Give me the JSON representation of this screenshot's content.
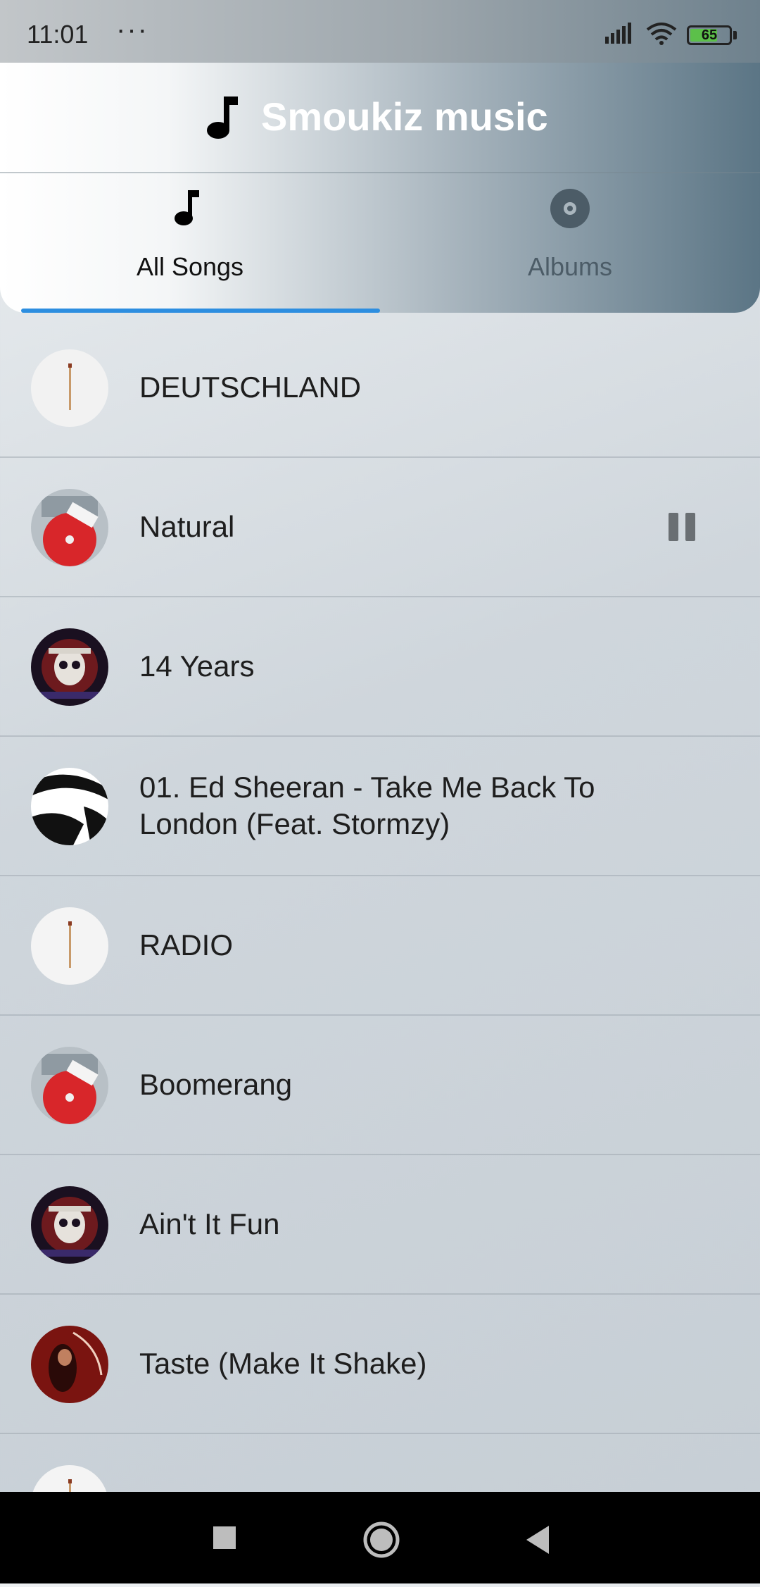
{
  "status_bar": {
    "time": "11:01",
    "more": "···",
    "battery": "65"
  },
  "header": {
    "app_title": "Smoukiz music",
    "title_icon": "music-note-icon",
    "tabs": [
      {
        "label": "All Songs",
        "icon": "music-note-icon",
        "selected": true
      },
      {
        "label": "Albums",
        "icon": "disc-icon",
        "selected": false
      }
    ],
    "accent_color": "#2d8ee0"
  },
  "songs": [
    {
      "title": "DEUTSCHLAND",
      "cover": "matchstick-cover"
    },
    {
      "title": "Natural",
      "cover": "red-disc-cover",
      "playing": true
    },
    {
      "title": "14 Years",
      "cover": "skull-cover"
    },
    {
      "title": "01. Ed Sheeran - Take Me Back To London (Feat. Stormzy)",
      "cover": "bw-cover"
    },
    {
      "title": "RADIO",
      "cover": "matchstick-cover"
    },
    {
      "title": "Boomerang",
      "cover": "red-disc-cover"
    },
    {
      "title": "Ain't It Fun",
      "cover": "skull-cover"
    },
    {
      "title": "Taste (Make It Shake)",
      "cover": "red-portrait-cover"
    },
    {
      "title": "",
      "cover": "matchstick-cover"
    }
  ],
  "nav_bar": {
    "buttons": [
      "recents-icon",
      "home-icon",
      "back-icon"
    ]
  }
}
